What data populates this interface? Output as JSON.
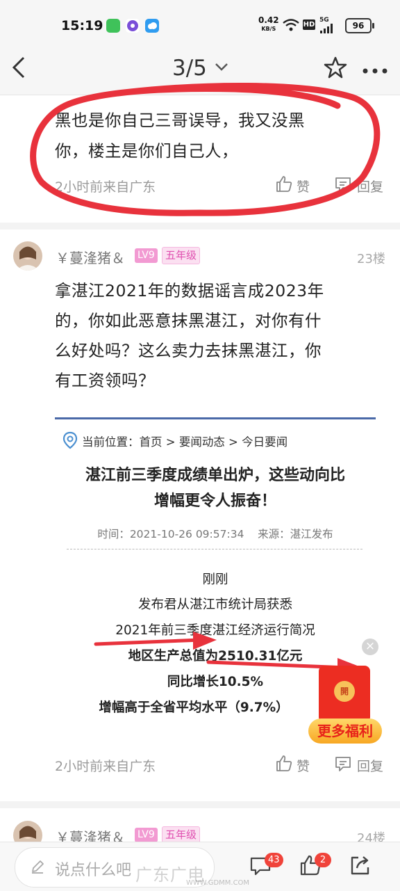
{
  "status_bar": {
    "time": "15:19",
    "net_speed": "0.42",
    "net_unit": "KB/S",
    "hd": "HD",
    "signal": "5G",
    "battery": "96"
  },
  "nav": {
    "pager": "3/5",
    "icons": [
      "back-arrow-icon",
      "chevron-down-icon",
      "star-icon",
      "more-icon"
    ]
  },
  "comment_top": {
    "text_line1": "黑也是你自己三哥误导，我又没黑",
    "text_line2": "你，楼主是你们自己人，",
    "meta": "2小时前来自广东",
    "like_label": "赞",
    "reply_label": "回复"
  },
  "comment_23": {
    "username": "￥蔓湰猪＆",
    "level": "LV9",
    "grade": "五年级",
    "floor": "23楼",
    "text_line1": "拿湛江2021年的数据谣言成2023年",
    "text_line2": "的，你如此恶意抹黑湛江，对你有什",
    "text_line3": "么好处吗？这么卖力去抹黑湛江，你",
    "text_line4": "有工资领吗？",
    "meta": "2小时前来自广东",
    "like_label": "赞",
    "reply_label": "回复",
    "image": {
      "location": "当前位置：首页 > 要闻动态 > 今日要闻",
      "title_line1": "湛江前三季度成绩单出炉，这些动向比",
      "title_line2": "增幅更令人振奋！",
      "time": "时间：2021-10-26 09:57:34",
      "source": "来源：湛江发布",
      "p1": "刚刚",
      "p2": "发布君从湛江市统计局获悉",
      "p3": "2021年前三季度湛江经济运行简况",
      "p4": "地区生产总值为2510.31亿元",
      "p5": "同比增长10.5%",
      "p6": "增幅高于全省平均水平（9.7%）"
    }
  },
  "comment_24": {
    "username": "￥蔓湰猪＆",
    "level": "LV9",
    "grade": "五年级",
    "floor": "24楼"
  },
  "ad": {
    "label": "更多福利",
    "coin": "開"
  },
  "bottom_bar": {
    "placeholder": "说点什么吧",
    "comment_count": "43",
    "like_count": "2"
  },
  "watermark": {
    "text": "广东广电",
    "url": "WWW.GDMM.COM"
  },
  "colors": {
    "annotation_red": "#e8323c",
    "level_pink": "#f29ad2",
    "article_rule": "#4a69a8",
    "badge_red": "#f0433a"
  }
}
